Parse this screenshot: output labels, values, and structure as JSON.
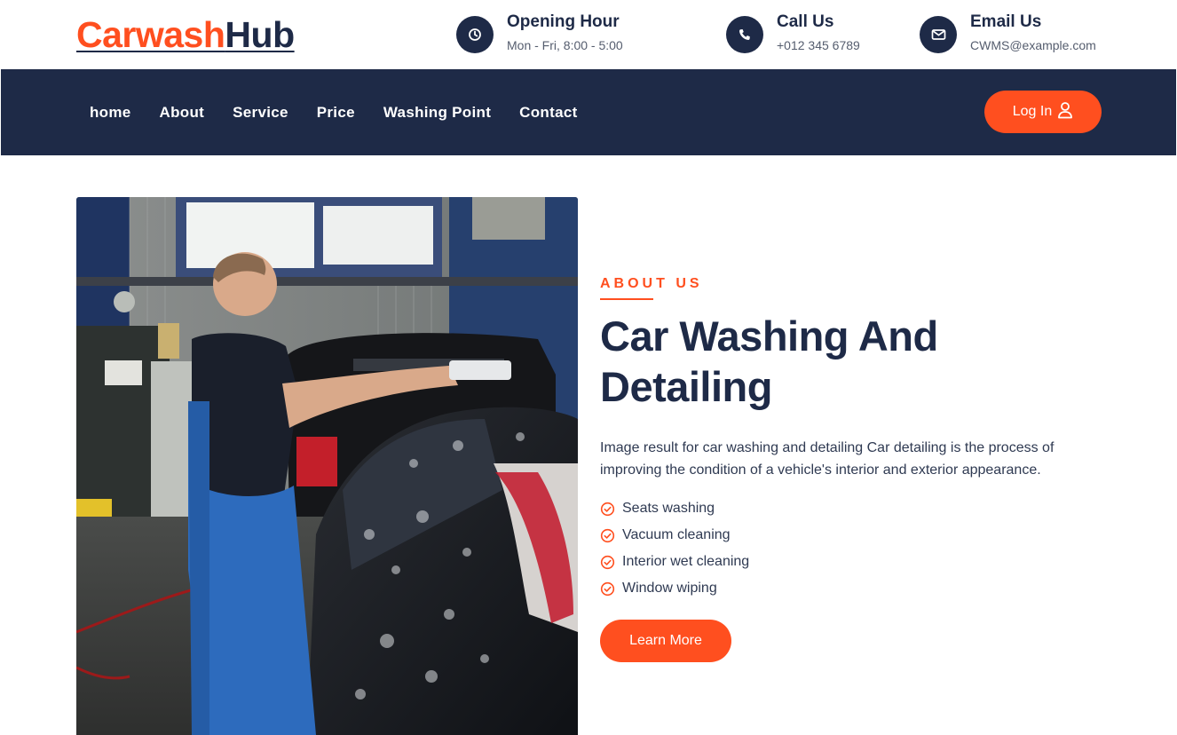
{
  "brand": {
    "part1": "Carwash",
    "part2": "Hub",
    "color_primary": "#ff4f1f",
    "color_dark": "#1e2a47"
  },
  "header": {
    "hours": {
      "icon": "clock-icon",
      "title": "Opening Hour",
      "value": "Mon - Fri, 8:00 - 5:00"
    },
    "call": {
      "icon": "phone-icon",
      "title": "Call Us",
      "value": "+012 345 6789"
    },
    "email": {
      "icon": "envelope-icon",
      "title": "Email Us",
      "value": "CWMS@example.com"
    }
  },
  "nav": {
    "items": [
      "home",
      "About",
      "Service",
      "Price",
      "Washing Point",
      "Contact"
    ],
    "login_label": "Log In",
    "login_icon": "user-icon"
  },
  "about": {
    "eyebrow": "ABOUT US",
    "heading": "Car Washing And Detailing",
    "description": "Image result for car washing and detailing Car detailing is the process of improving the condition of a vehicle's interior and exterior appearance.",
    "features": [
      "Seats washing",
      "Vacuum cleaning",
      "Interior wet cleaning",
      "Window wiping"
    ],
    "feature_icon": "check-circle-icon",
    "cta_label": "Learn More"
  }
}
